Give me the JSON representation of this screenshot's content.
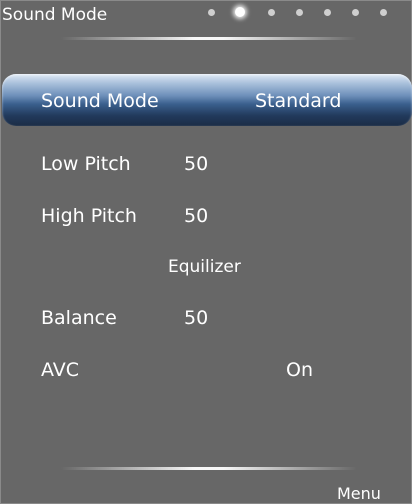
{
  "header": {
    "title": "Sound Mode",
    "page_indicator": {
      "count": 7,
      "active_index": 1
    }
  },
  "menu": {
    "sound_mode": {
      "label": "Sound Mode",
      "value": "Standard"
    },
    "low_pitch": {
      "label": "Low Pitch",
      "value": "50"
    },
    "high_pitch": {
      "label": "High Pitch",
      "value": "50"
    },
    "equalizer": {
      "label": "Equilizer"
    },
    "balance": {
      "label": "Balance",
      "value": "50"
    },
    "avc": {
      "label": "AVC",
      "value": "On"
    }
  },
  "footer": {
    "menu_label": "Menu"
  },
  "colors": {
    "background": "#676767",
    "text": "#ffffff",
    "highlight_top": "#a9c0db",
    "highlight_bottom": "#223a5c"
  }
}
